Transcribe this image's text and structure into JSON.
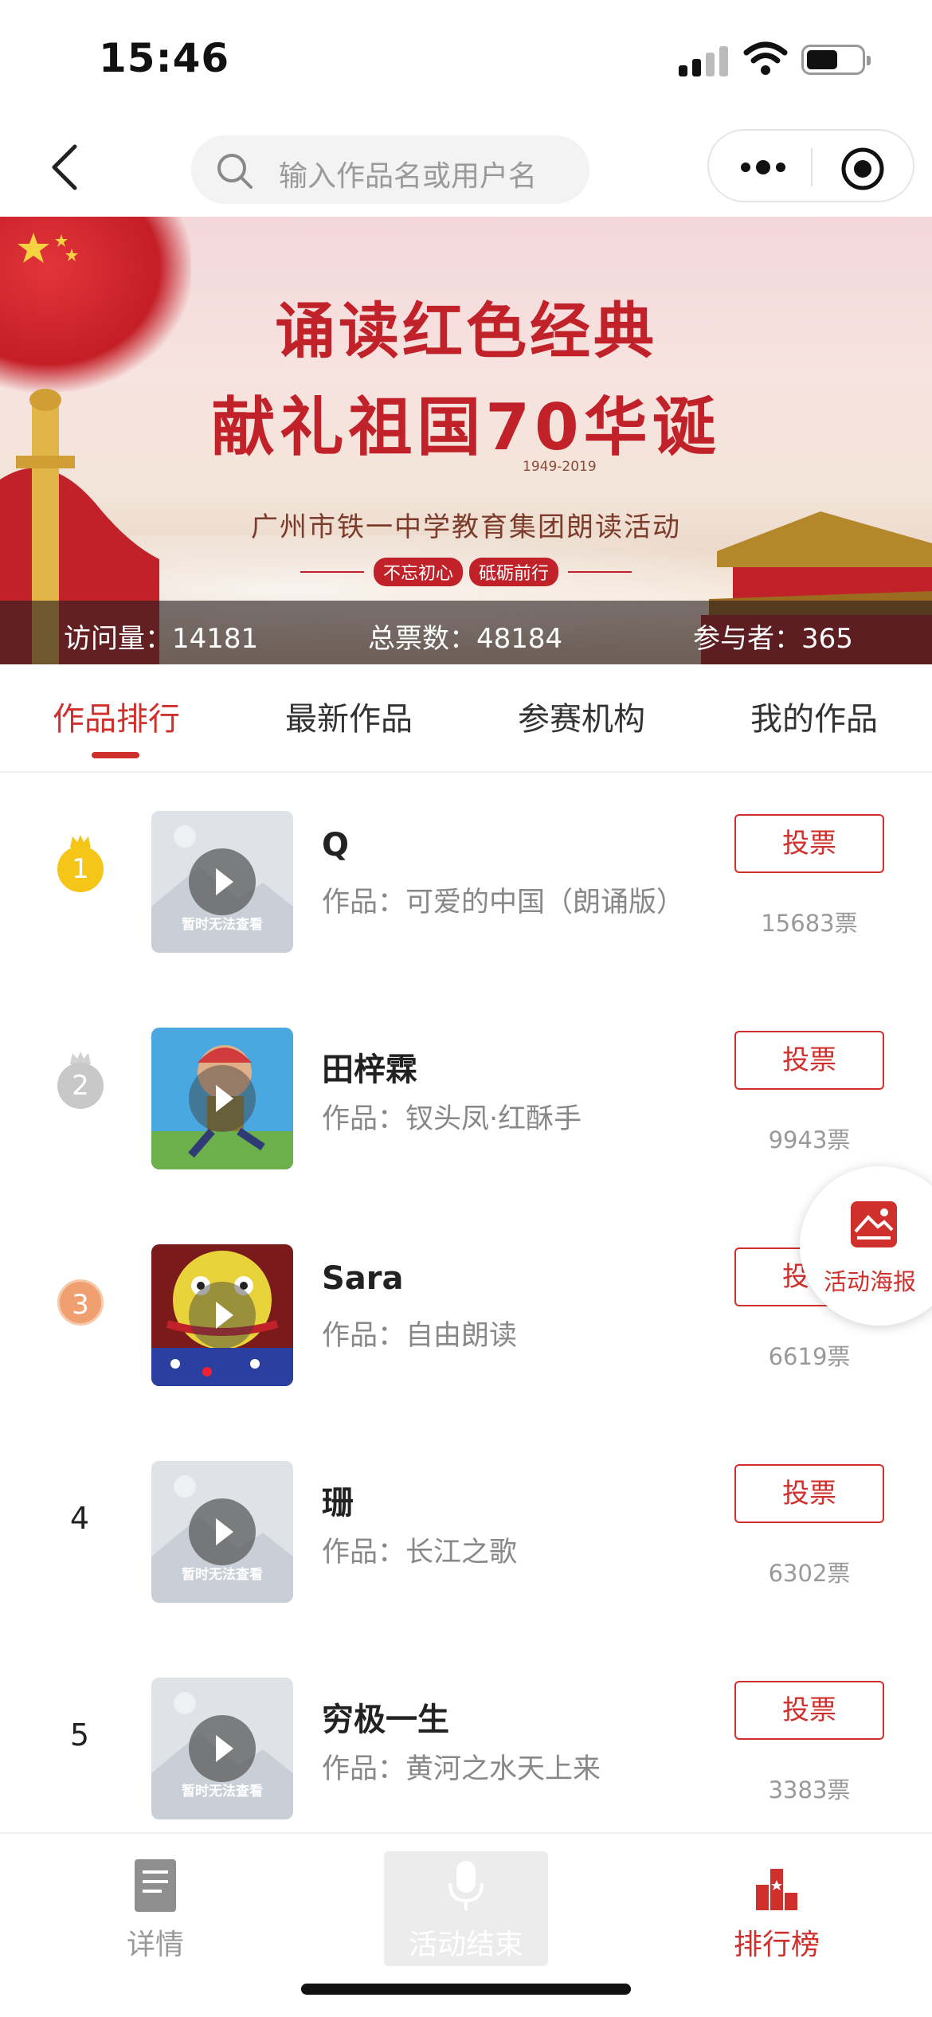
{
  "status_bar": {
    "time": "15:46"
  },
  "nav": {
    "search_placeholder": "输入作品名或用户名"
  },
  "banner": {
    "title_line1": "诵读红色经典",
    "title_line2": "献礼祖国70华诞",
    "years": "1949-2019",
    "subtitle": "广州市铁一中学教育集团朗读活动",
    "slogan_left": "不忘初心",
    "slogan_right": "砥砺前行",
    "stats": {
      "visits": "访问量：14181",
      "total_votes": "总票数：48184",
      "participants": "参与者：365"
    }
  },
  "tabs": [
    {
      "label": "作品排行",
      "active": true
    },
    {
      "label": "最新作品",
      "active": false
    },
    {
      "label": "参赛机构",
      "active": false
    },
    {
      "label": "我的作品",
      "active": false
    }
  ],
  "rankings": [
    {
      "rank": "1",
      "medal": "gold",
      "name": "Q",
      "work": "作品：可爱的中国（朗诵版）",
      "votes": "15683票",
      "thumb": "placeholder"
    },
    {
      "rank": "2",
      "medal": "silver",
      "name": "田梓霖",
      "work": "作品：钗头凤·红酥手",
      "votes": "9943票",
      "thumb": "cartoon-boy"
    },
    {
      "rank": "3",
      "medal": "bronze",
      "name": "Sara",
      "work": "作品：自由朗读",
      "votes": "6619票",
      "thumb": "colorful-drawing"
    },
    {
      "rank": "4",
      "medal": "",
      "name": "珊",
      "work": "作品：长江之歌",
      "votes": "6302票",
      "thumb": "placeholder"
    },
    {
      "rank": "5",
      "medal": "",
      "name": "穷极一生",
      "work": "作品：黄河之水天上来",
      "votes": "3383票",
      "thumb": "placeholder"
    }
  ],
  "vote_label": "投票",
  "thumb_placeholder_text": "暂时无法查看",
  "poster_fab": {
    "label": "活动海报",
    "icon": "poster-image-icon"
  },
  "bottom_bar": {
    "details": {
      "label": "详情",
      "icon": "document-icon"
    },
    "center": {
      "label": "活动结束",
      "icon": "microphone-icon"
    },
    "leaderboard": {
      "label": "排行榜",
      "icon": "leaderboard-icon"
    }
  },
  "colors": {
    "accent": "#d0302c",
    "gold": "#f5c518",
    "silver": "#c8c8c8",
    "bronze": "#f0a070"
  }
}
